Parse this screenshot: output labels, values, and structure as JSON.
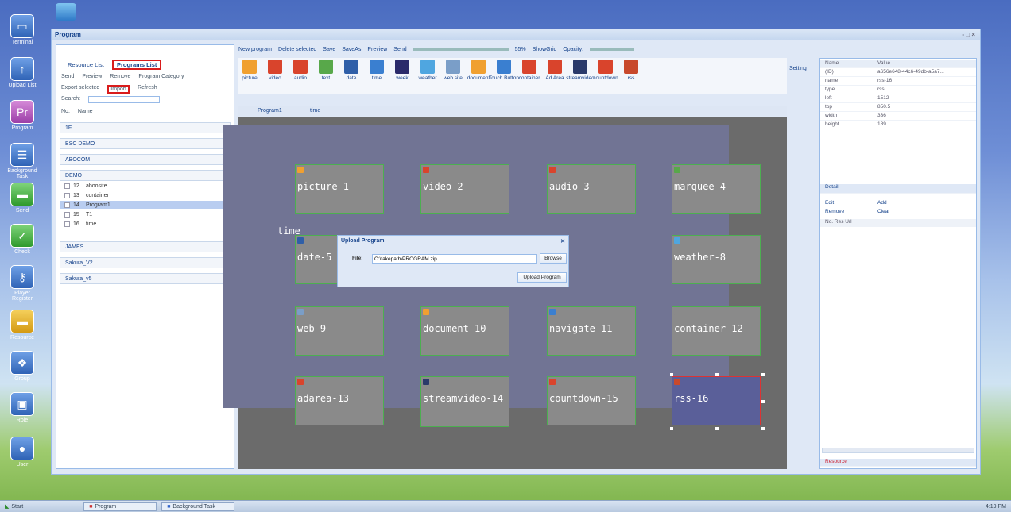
{
  "desktop": {
    "icons": [
      {
        "label": "Terminal"
      },
      {
        "label": "Upload List"
      },
      {
        "label": "Program"
      },
      {
        "label": "Background Task"
      },
      {
        "label": "Send"
      },
      {
        "label": "Check"
      },
      {
        "label": "Player Register"
      },
      {
        "label": "Resource"
      },
      {
        "label": "Group"
      },
      {
        "label": "Role"
      },
      {
        "label": "User"
      }
    ]
  },
  "taskbar": {
    "start": "Start",
    "tasks": [
      "Program",
      "Background Task"
    ],
    "clock": "4:19 PM"
  },
  "window": {
    "title": "Program",
    "controls": "- □ ×"
  },
  "left_panel": {
    "tabs": [
      "Resource List",
      "Programs List"
    ],
    "actions_row1": [
      "Send",
      "Preview",
      "Remove",
      "Program Category"
    ],
    "actions_row2": [
      "Export selected",
      "Import",
      "Refresh"
    ],
    "search_label": "Search:",
    "col_no": "No.",
    "col_name": "Name",
    "groups_top": [
      "1F",
      "BSC DEMO",
      "ABOCOM",
      "DEMO"
    ],
    "items": [
      {
        "no": "12",
        "name": "aboosite",
        "selected": false
      },
      {
        "no": "13",
        "name": "container",
        "selected": false
      },
      {
        "no": "14",
        "name": "Program1",
        "selected": true
      },
      {
        "no": "15",
        "name": "T1",
        "selected": false
      },
      {
        "no": "16",
        "name": "time",
        "selected": false
      }
    ],
    "groups_bottom": [
      "JAMES",
      "Sakura_V2",
      "Sakura_v5"
    ]
  },
  "toolbar": {
    "buttons": [
      "New program",
      "Delete selected",
      "Save",
      "SaveAs",
      "Preview",
      "Send"
    ],
    "zoom": "55%",
    "showgrid": "ShowGrid",
    "opacity": "Opacity:",
    "setting": "Setting"
  },
  "tools": [
    "picture",
    "video",
    "audio",
    "text",
    "date",
    "time",
    "week",
    "weather",
    "web site",
    "document",
    "Touch Button",
    "container",
    "Ad Area",
    "streamvideo",
    "countdown",
    "rss"
  ],
  "doc_tabs": [
    "Program1",
    "time"
  ],
  "canvas": {
    "time_label": "time",
    "regions": [
      "picture-1",
      "video-2",
      "audio-3",
      "marquee-4",
      "date-5",
      "weather-8",
      "web-9",
      "document-10",
      "navigate-11",
      "container-12",
      "adarea-13",
      "streamvideo-14",
      "countdown-15",
      "rss-16"
    ]
  },
  "dialog": {
    "title": "Upload Program",
    "file_label": "File:",
    "file_value": "C:\\fakepath\\PROGRAM.zip",
    "browse": "Browse",
    "upload": "Upload Program"
  },
  "properties": {
    "header_name": "Name",
    "header_value": "Value",
    "rows": [
      {
        "k": "(ID)",
        "v": "a656e648-44c6-49db-a5a7..."
      },
      {
        "k": "name",
        "v": "rss-16"
      },
      {
        "k": "type",
        "v": "rss"
      },
      {
        "k": "left",
        "v": "1512"
      },
      {
        "k": "top",
        "v": "850.5"
      },
      {
        "k": "width",
        "v": "336"
      },
      {
        "k": "height",
        "v": "189"
      }
    ],
    "detail": "Detail",
    "edit": "Edit",
    "add": "Add",
    "remove": "Remove",
    "clear": "Clear",
    "res_header": "No. Res Url",
    "footer": "Resource"
  }
}
